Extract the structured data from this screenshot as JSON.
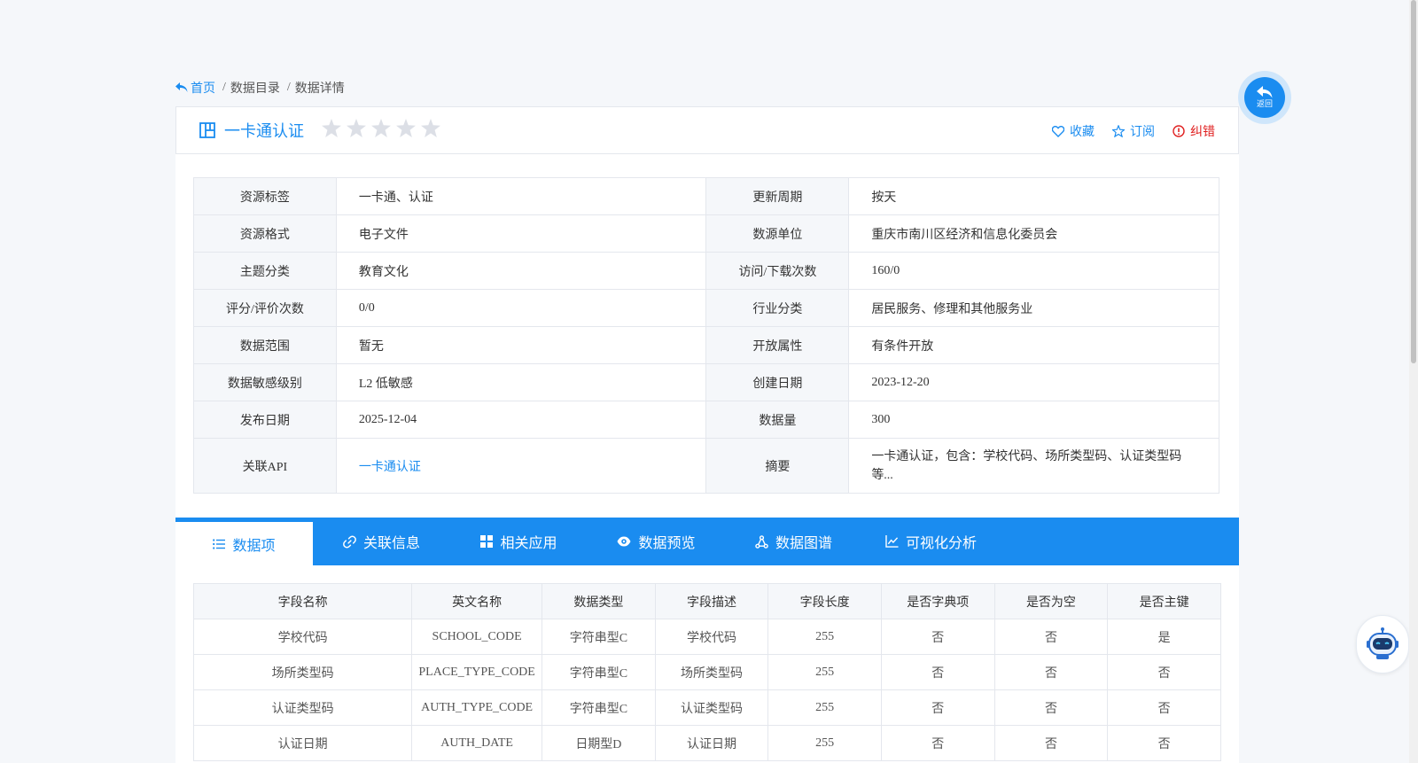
{
  "breadcrumb": {
    "home": "首页",
    "catalog": "数据目录",
    "detail": "数据详情",
    "separator": "/"
  },
  "title": {
    "text": "一卡通认证",
    "rating_stars": 5,
    "rating_filled": 0
  },
  "actions": {
    "favorite": "收藏",
    "subscribe": "订阅",
    "report_error": "纠错"
  },
  "info": {
    "rows": [
      {
        "k1": "资源标签",
        "v1": "一卡通、认证",
        "k2": "更新周期",
        "v2": "按天"
      },
      {
        "k1": "资源格式",
        "v1": "电子文件",
        "k2": "数源单位",
        "v2": "重庆市南川区经济和信息化委员会"
      },
      {
        "k1": "主题分类",
        "v1": "教育文化",
        "k2": "访问/下载次数",
        "v2": "160/0"
      },
      {
        "k1": "评分/评价次数",
        "v1": "0/0",
        "k2": "行业分类",
        "v2": "居民服务、修理和其他服务业"
      },
      {
        "k1": "数据范围",
        "v1": "暂无",
        "k2": "开放属性",
        "v2": "有条件开放"
      },
      {
        "k1": "数据敏感级别",
        "v1": "L2 低敏感",
        "k2": "创建日期",
        "v2": "2023-12-20"
      },
      {
        "k1": "发布日期",
        "v1": "2025-12-04",
        "k2": "数据量",
        "v2": "300"
      }
    ],
    "api_label": "关联API",
    "api_link": "一卡通认证",
    "summary_label": "摘要",
    "summary": "一卡通认证，包含：学校代码、场所类型码、认证类型码等..."
  },
  "tabs": [
    "数据项",
    "关联信息",
    "相关应用",
    "数据预览",
    "数据图谱",
    "可视化分析"
  ],
  "fields": {
    "headers": [
      "字段名称",
      "英文名称",
      "数据类型",
      "字段描述",
      "字段长度",
      "是否字典项",
      "是否为空",
      "是否主键"
    ],
    "rows": [
      [
        "学校代码",
        "SCHOOL_CODE",
        "字符串型C",
        "学校代码",
        "255",
        "否",
        "否",
        "是"
      ],
      [
        "场所类型码",
        "PLACE_TYPE_CODE",
        "字符串型C",
        "场所类型码",
        "255",
        "否",
        "否",
        "否"
      ],
      [
        "认证类型码",
        "AUTH_TYPE_CODE",
        "字符串型C",
        "认证类型码",
        "255",
        "否",
        "否",
        "否"
      ],
      [
        "认证日期",
        "AUTH_DATE",
        "日期型D",
        "认证日期",
        "255",
        "否",
        "否",
        "否"
      ]
    ]
  },
  "back_button": {
    "label": "返回"
  },
  "colors": {
    "primary": "#1a8cf0",
    "danger": "#e02020",
    "border": "#e4e7ed",
    "header_bg": "#f5f7fa",
    "star": "#dcdfe6"
  }
}
